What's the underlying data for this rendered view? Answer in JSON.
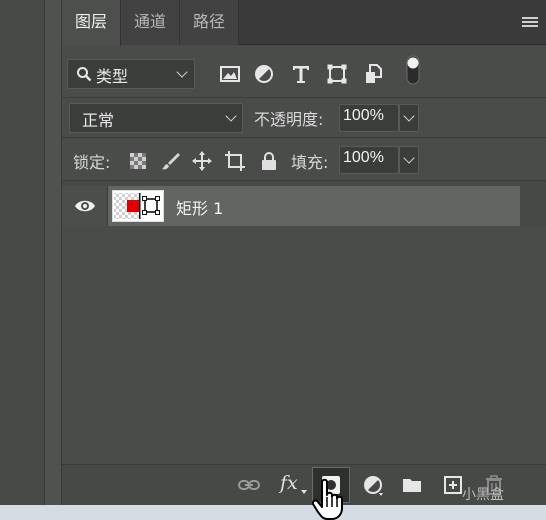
{
  "tabs": [
    {
      "label": "图层",
      "active": true
    },
    {
      "label": "通道",
      "active": false
    },
    {
      "label": "路径",
      "active": false
    }
  ],
  "filter": {
    "kind_label": "类型",
    "icons": [
      "image-filter-icon",
      "adjustment-filter-icon",
      "type-filter-icon",
      "shape-filter-icon",
      "smart-object-filter-icon",
      "filter-toggle-icon"
    ]
  },
  "blend": {
    "mode": "正常",
    "opacity_label": "不透明度:",
    "opacity_value": "100%"
  },
  "lock": {
    "label": "锁定:",
    "fill_label": "填充:",
    "fill_value": "100%",
    "icons": [
      "lock-transparent-pixels-icon",
      "lock-image-pixels-icon",
      "lock-position-icon",
      "lock-artboard-icon",
      "lock-all-icon"
    ]
  },
  "layers": [
    {
      "name": "矩形 1",
      "visible": true,
      "thumb_color": "#e10000"
    }
  ],
  "bottom_bar": {
    "icons": [
      "link-layers-icon",
      "layer-style-fx-icon",
      "add-mask-icon",
      "adjustment-layer-icon",
      "group-folder-icon",
      "new-layer-icon",
      "delete-layer-icon"
    ],
    "fx_label": "fx"
  },
  "watermark": "小黑盒",
  "colors": {
    "accent": "#e10000",
    "panel": "#474947"
  }
}
